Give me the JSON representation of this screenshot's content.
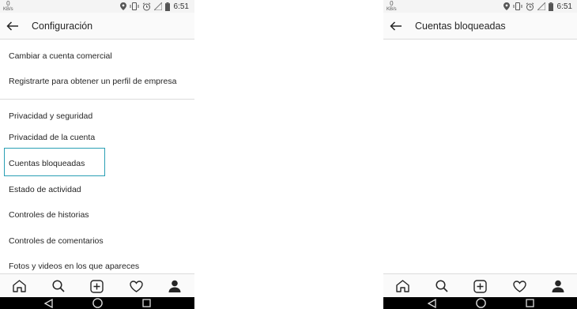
{
  "status": {
    "speed_value": "0",
    "speed_unit": "KB/s",
    "time": "6:51"
  },
  "left": {
    "title": "Configuración",
    "rows": [
      "Cambiar a cuenta comercial",
      "Registrarte para obtener un perfil de empresa"
    ],
    "section_heading": "Privacidad y seguridad",
    "privacy_items": [
      "Privacidad de la cuenta",
      "Cuentas bloqueadas",
      "Estado de actividad",
      "Controles de historias",
      "Controles de comentarios",
      "Fotos y videos en los que apareces"
    ],
    "highlighted_item": "Cuentas bloqueadas"
  },
  "right": {
    "title": "Cuentas bloqueadas"
  },
  "tabbar": [
    "home-icon",
    "search-icon",
    "add-post-icon",
    "activity-heart-icon",
    "profile-icon"
  ],
  "navbar": [
    "nav-back-icon",
    "nav-home-icon",
    "nav-recents-icon"
  ],
  "colors": {
    "highlight_border": "#2a9fb5",
    "divider": "#dbdbdb",
    "text": "#262626",
    "navbar": "#000000"
  }
}
